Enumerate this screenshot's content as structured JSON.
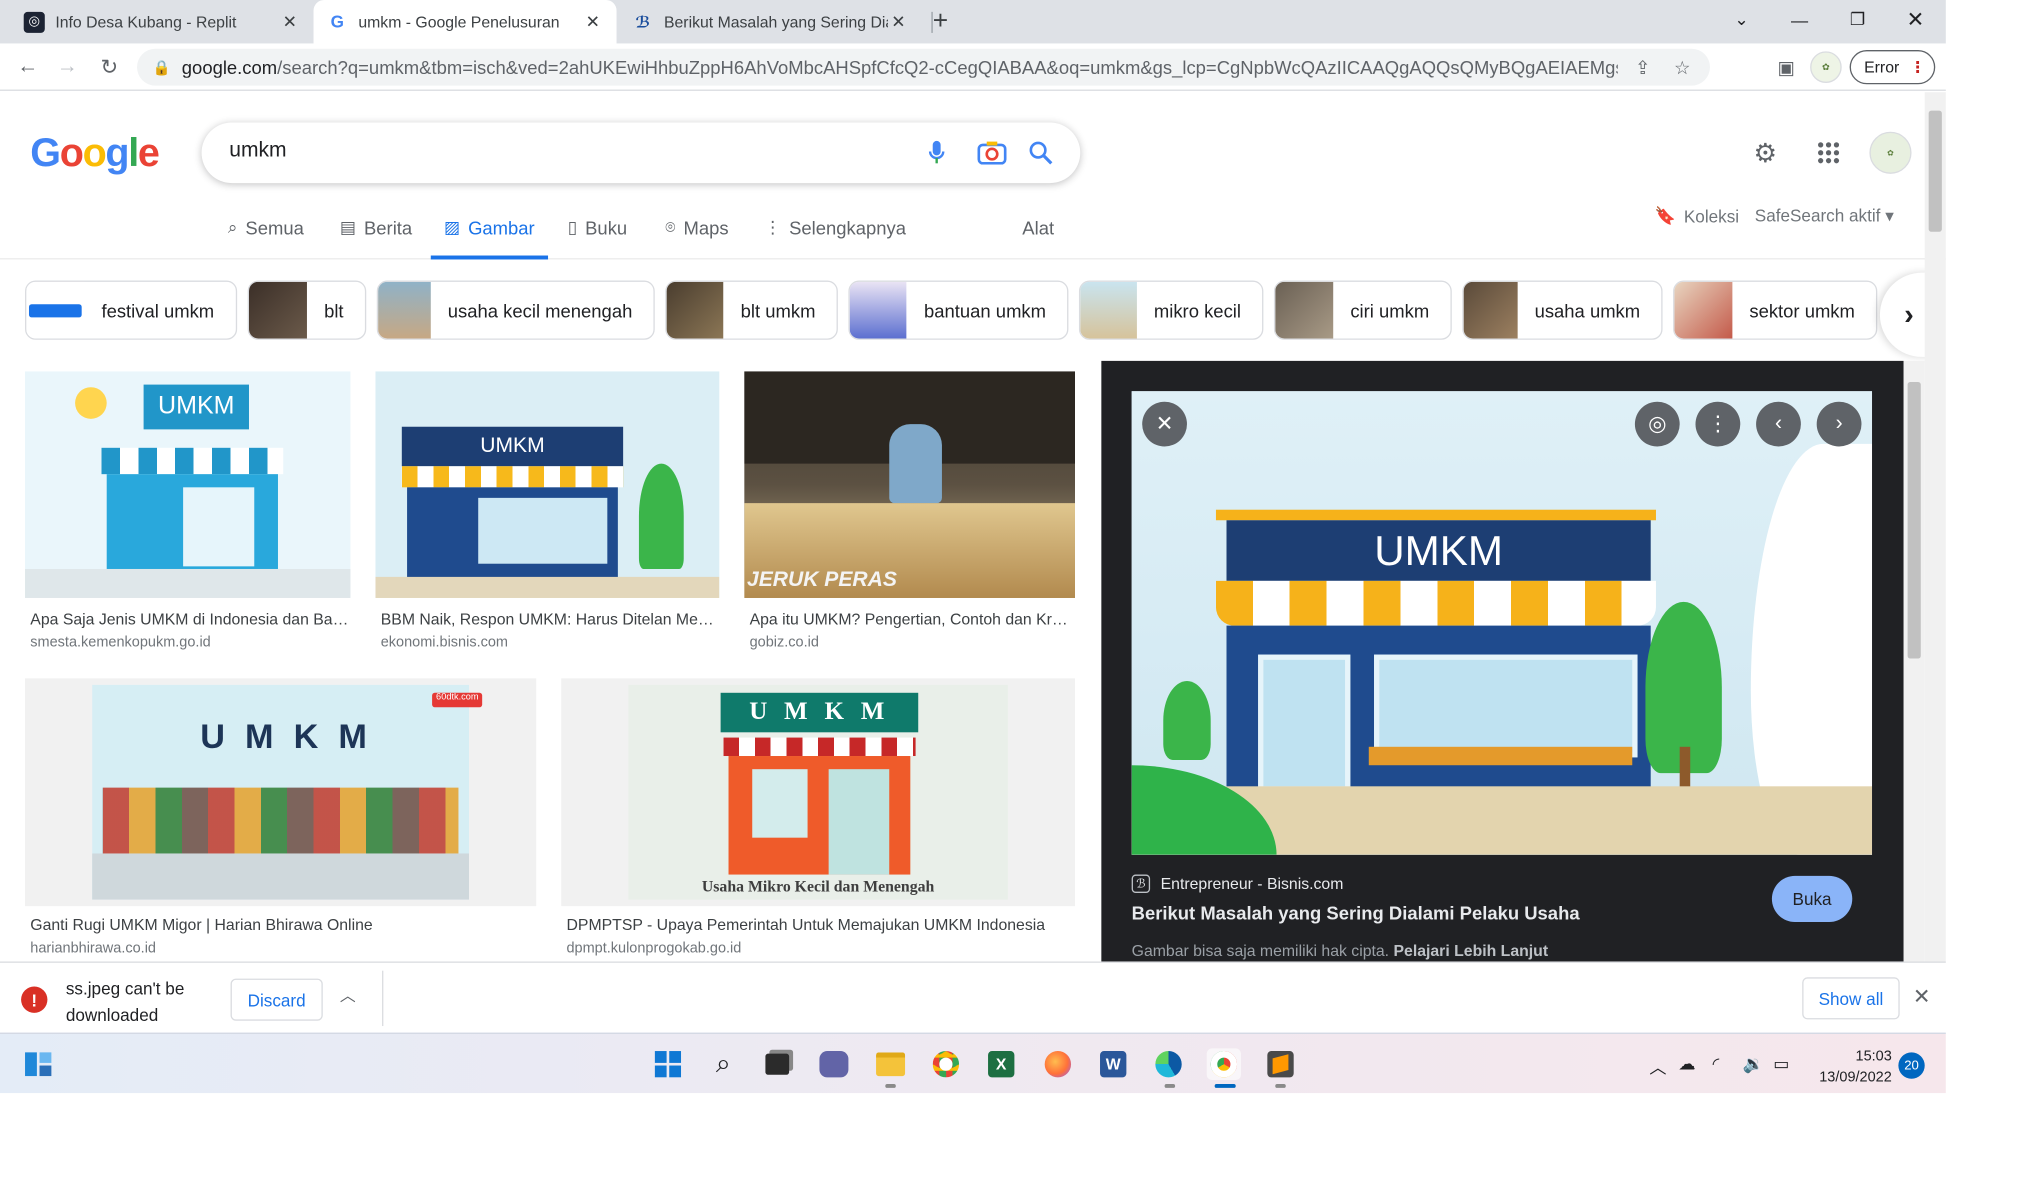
{
  "browser": {
    "tabs": [
      {
        "title": "Info Desa Kubang - Replit",
        "icon": "replit-icon"
      },
      {
        "title": "umkm - Google Penelusuran",
        "icon": "google-icon"
      },
      {
        "title": "Berikut Masalah yang Sering Dial",
        "icon": "bisnis-icon"
      }
    ],
    "url_main": "google.com",
    "url_rest": "/search?q=umkm&tbm=isch&ved=2ahUKEwiHhbuZppH6AhVoMbcAHSpfCfcQ2-cCegQIABAA&oq=umkm&gs_lcp=CgNpbWcQAzIICAAQgAQQsQMyBQgAEIAEMgsIABCABBCxA...",
    "error_label": "Error"
  },
  "google": {
    "logo": "Google",
    "query": "umkm",
    "nav": [
      {
        "label": "Semua",
        "icon": "search-icon"
      },
      {
        "label": "Berita",
        "icon": "news-icon"
      },
      {
        "label": "Gambar",
        "icon": "image-icon"
      },
      {
        "label": "Buku",
        "icon": "book-icon"
      },
      {
        "label": "Maps",
        "icon": "map-pin-icon"
      },
      {
        "label": "Selengkapnya",
        "icon": "more-vert-icon"
      }
    ],
    "tools": "Alat",
    "koleksi": "Koleksi",
    "safesearch": "SafeSearch aktif",
    "chips": [
      "festival umkm",
      "blt",
      "usaha kecil menengah",
      "blt umkm",
      "bantuan umkm",
      "mikro kecil",
      "ciri umkm",
      "usaha umkm",
      "sektor umkm"
    ],
    "results": [
      {
        "caption": "Apa Saja Jenis UMKM di Indonesia dan Bag...",
        "source": "smesta.kemenkopukm.go.id",
        "img_text": "UMKM"
      },
      {
        "caption": "BBM Naik, Respon UMKM: Harus Ditelan Mes...",
        "source": "ekonomi.bisnis.com",
        "img_text": "UMKM"
      },
      {
        "caption": "Apa itu UMKM? Pengertian, Contoh dan Krit...",
        "source": "gobiz.co.id",
        "img_text": "JERUK PERAS"
      },
      {
        "caption": "Ganti Rugi UMKM Migor | Harian Bhirawa Online",
        "source": "harianbhirawa.co.id",
        "img_text": "U M K M",
        "badge": "60dtk.com"
      },
      {
        "caption": "DPMPTSP - Upaya Pemerintah Untuk Memajukan UMKM Indonesia",
        "source": "dpmpt.kulonprogokab.go.id",
        "img_text": "U M K M",
        "sub_text": "Usaha Mikro Kecil dan Menengah"
      }
    ],
    "preview": {
      "img_text": "UMKM",
      "site": "Entrepreneur - Bisnis.com",
      "title": "Berikut Masalah yang Sering Dialami Pelaku Usaha",
      "open": "Buka",
      "copyright": "Gambar bisa saja memiliki hak cipta.",
      "learn_more": "Pelajari Lebih Lanjut"
    }
  },
  "download": {
    "message": "ss.jpeg  can't be downloaded securely",
    "discard": "Discard",
    "show_all": "Show all"
  },
  "taskbar": {
    "time": "15:03",
    "date": "13/09/2022",
    "notifications": "20"
  }
}
